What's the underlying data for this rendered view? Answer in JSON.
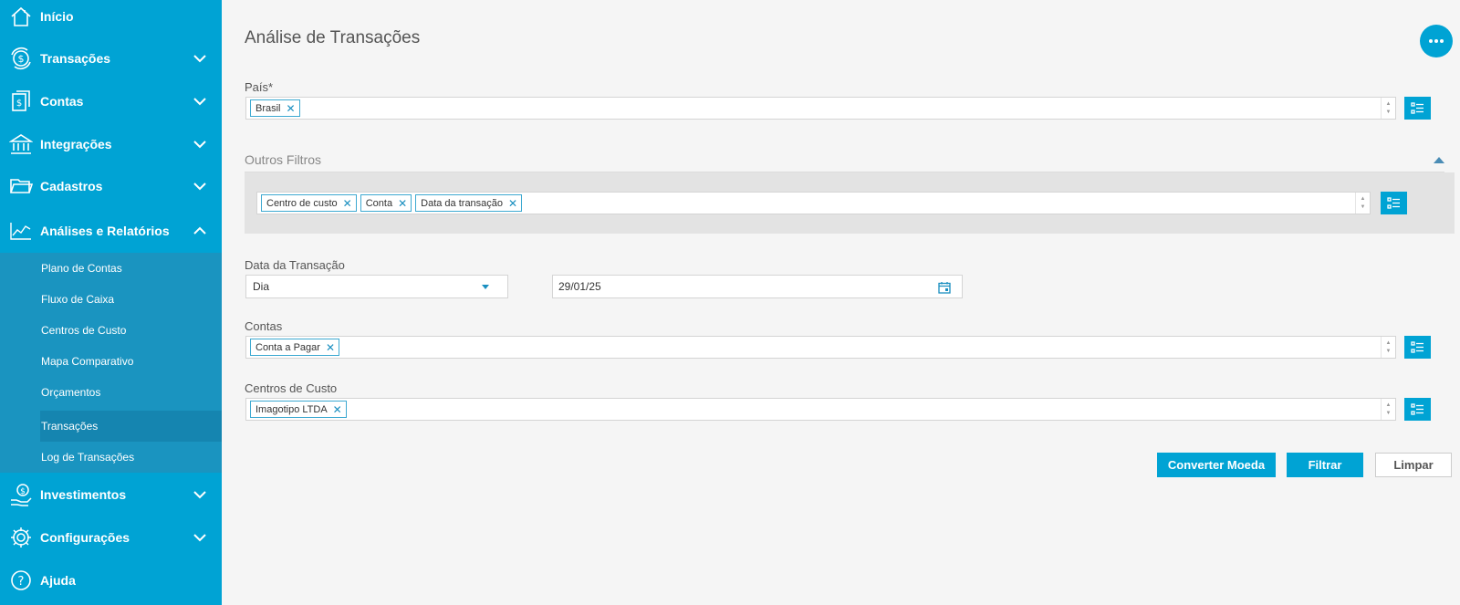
{
  "sidebar": {
    "items": [
      {
        "label": "Início",
        "icon": "home-icon"
      },
      {
        "label": "Transações",
        "icon": "money-cycle-icon"
      },
      {
        "label": "Contas",
        "icon": "document-money-icon"
      },
      {
        "label": "Integrações",
        "icon": "bank-icon"
      },
      {
        "label": "Cadastros",
        "icon": "folder-icon"
      },
      {
        "label": "Análises e Relatórios",
        "icon": "chart-line-icon"
      },
      {
        "label": "Investimentos",
        "icon": "hand-coin-icon"
      },
      {
        "label": "Configurações",
        "icon": "gear-icon"
      },
      {
        "label": "Ajuda",
        "icon": "help-icon"
      }
    ],
    "submenu": [
      {
        "label": "Plano de Contas"
      },
      {
        "label": "Fluxo de Caixa"
      },
      {
        "label": "Centros de Custo"
      },
      {
        "label": "Mapa Comparativo"
      },
      {
        "label": "Orçamentos"
      },
      {
        "label": "Transações"
      },
      {
        "label": "Log de Transações"
      }
    ],
    "active_submenu": "Transações"
  },
  "main": {
    "title": "Análise de Transações",
    "pais": {
      "label": "País*",
      "tags": [
        "Brasil"
      ]
    },
    "outros_filtros": {
      "title": "Outros Filtros",
      "tags": [
        "Centro de custo",
        "Conta",
        "Data da transação"
      ]
    },
    "data_transacao": {
      "label": "Data da Transação",
      "period": "Dia",
      "date": "29/01/25"
    },
    "contas": {
      "label": "Contas",
      "tags": [
        "Conta a Pagar"
      ]
    },
    "centros_custo": {
      "label": "Centros de Custo",
      "tags": [
        "Imagotipo LTDA"
      ]
    },
    "buttons": {
      "convert": "Converter Moeda",
      "filter": "Filtrar",
      "clear": "Limpar"
    }
  },
  "colors": {
    "accent": "#00a3d4",
    "submenu_bg": "#1a94c0",
    "active_bg": "#1585b0",
    "page_bg": "#f5f5f5"
  }
}
